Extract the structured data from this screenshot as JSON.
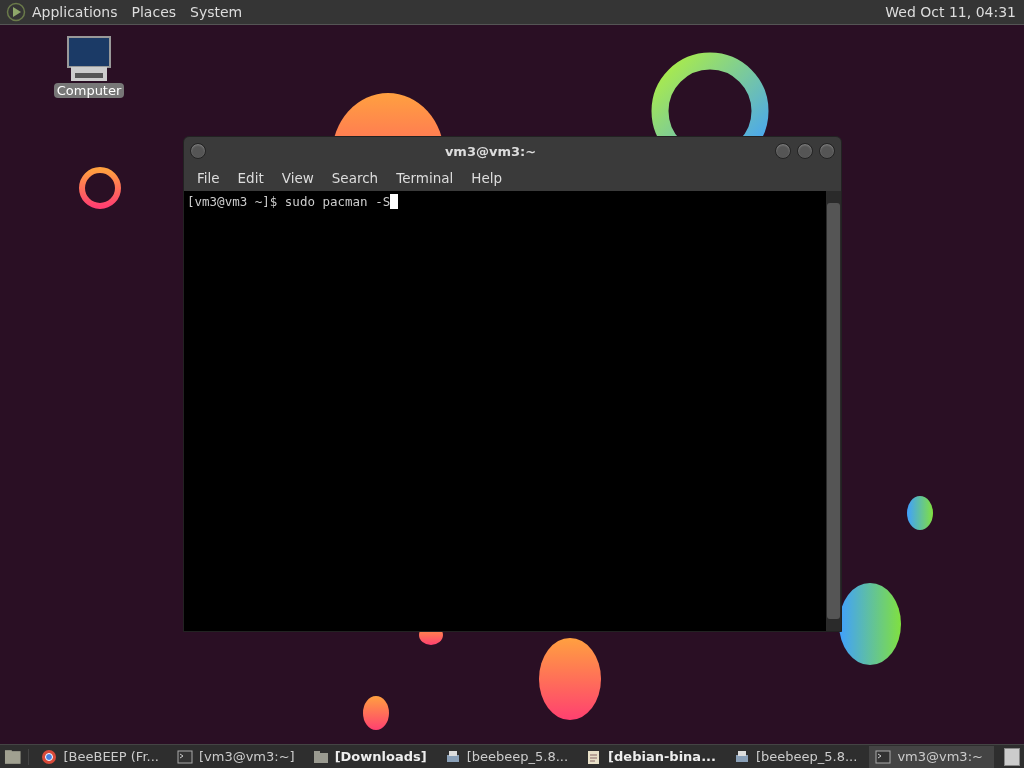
{
  "top_panel": {
    "menus": [
      "Applications",
      "Places",
      "System"
    ],
    "clock": "Wed Oct 11, 04:31"
  },
  "desktop_icons": [
    {
      "label": "Computer"
    }
  ],
  "terminal": {
    "title": "vm3@vm3:~",
    "menus": [
      "File",
      "Edit",
      "View",
      "Search",
      "Terminal",
      "Help"
    ],
    "lines": [
      "[vm3@vm3 ~]$ sudo pacman -S"
    ]
  },
  "taskbar": {
    "items": [
      {
        "label": "[BeeBEEP (Fr...",
        "kind": "browser",
        "urgent": false,
        "selected": false
      },
      {
        "label": "[vm3@vm3:~]",
        "kind": "terminal",
        "urgent": false,
        "selected": false
      },
      {
        "label": "[Downloads]",
        "kind": "folder",
        "urgent": true,
        "selected": false
      },
      {
        "label": "[beebeep_5.8...",
        "kind": "printer",
        "urgent": false,
        "selected": false
      },
      {
        "label": "[debian-bina...",
        "kind": "note",
        "urgent": true,
        "selected": false
      },
      {
        "label": "[beebeep_5.8...",
        "kind": "printer",
        "urgent": false,
        "selected": false
      },
      {
        "label": "vm3@vm3:~",
        "kind": "terminal",
        "urgent": false,
        "selected": true
      }
    ]
  }
}
